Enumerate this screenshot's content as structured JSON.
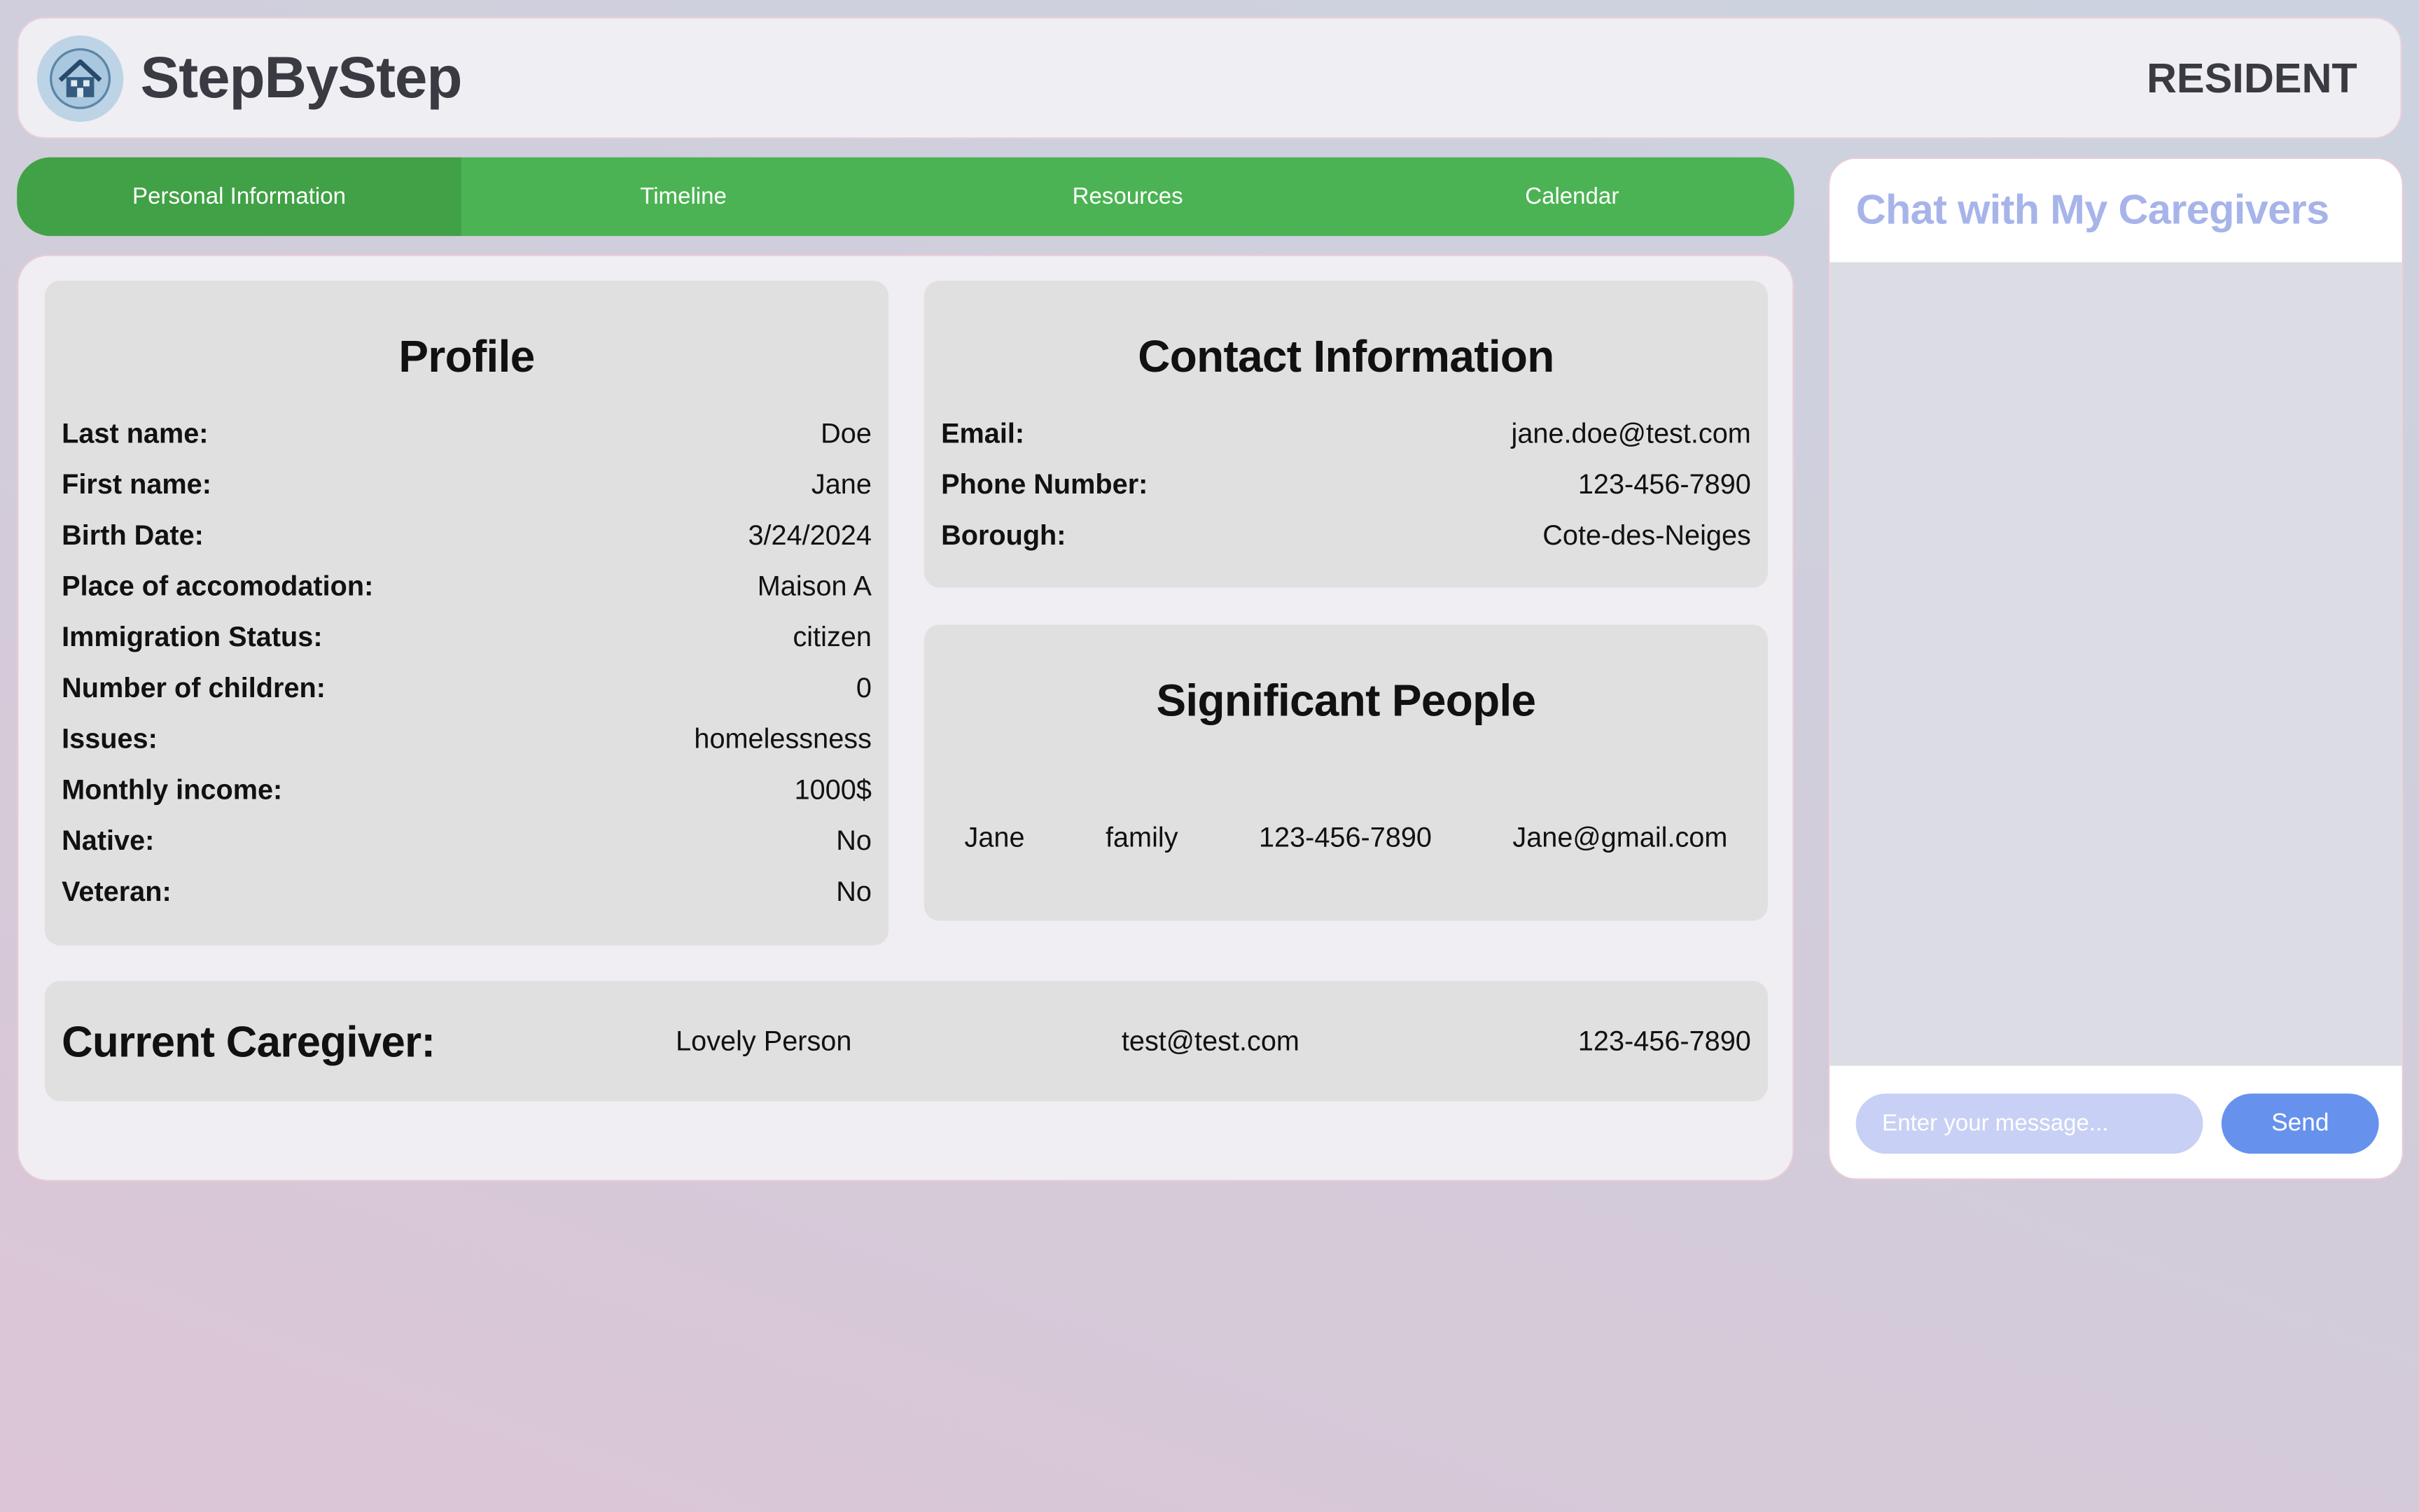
{
  "header": {
    "app_name": "StepByStep",
    "role": "RESIDENT",
    "logo_icon": "house-icon"
  },
  "tabs": [
    {
      "label": "Personal Information",
      "active": true
    },
    {
      "label": "Timeline",
      "active": false
    },
    {
      "label": "Resources",
      "active": false
    },
    {
      "label": "Calendar",
      "active": false
    }
  ],
  "profile": {
    "title": "Profile",
    "fields": [
      {
        "label": "Last name:",
        "value": "Doe"
      },
      {
        "label": "First name:",
        "value": "Jane"
      },
      {
        "label": "Birth Date:",
        "value": "3/24/2024"
      },
      {
        "label": "Place of accomodation:",
        "value": "Maison A"
      },
      {
        "label": "Immigration Status:",
        "value": "citizen"
      },
      {
        "label": "Number of children:",
        "value": "0"
      },
      {
        "label": "Issues:",
        "value": "homelessness"
      },
      {
        "label": "Monthly income:",
        "value": "1000$"
      },
      {
        "label": "Native:",
        "value": "No"
      },
      {
        "label": "Veteran:",
        "value": "No"
      }
    ]
  },
  "contact": {
    "title": "Contact Information",
    "fields": [
      {
        "label": "Email:",
        "value": "jane.doe@test.com"
      },
      {
        "label": "Phone Number:",
        "value": "123-456-7890"
      },
      {
        "label": "Borough:",
        "value": "Cote-des-Neiges"
      }
    ]
  },
  "significant_people": {
    "title": "Significant People",
    "people": [
      {
        "name": "Jane",
        "relation": "family",
        "phone": "123-456-7890",
        "email": "Jane@gmail.com"
      }
    ]
  },
  "caregiver": {
    "title": "Current Caregiver:",
    "name": "Lovely Person",
    "email": "test@test.com",
    "phone": "123-456-7890"
  },
  "chat": {
    "title": "Chat with My Caregivers",
    "placeholder": "Enter your message...",
    "send_label": "Send"
  },
  "colors": {
    "tab_bar": "#4bb353",
    "active_tab": "#41a146",
    "chat_title": "#a7b4ea",
    "send_button": "#6692ee",
    "chat_input": "#c8d0f5"
  }
}
